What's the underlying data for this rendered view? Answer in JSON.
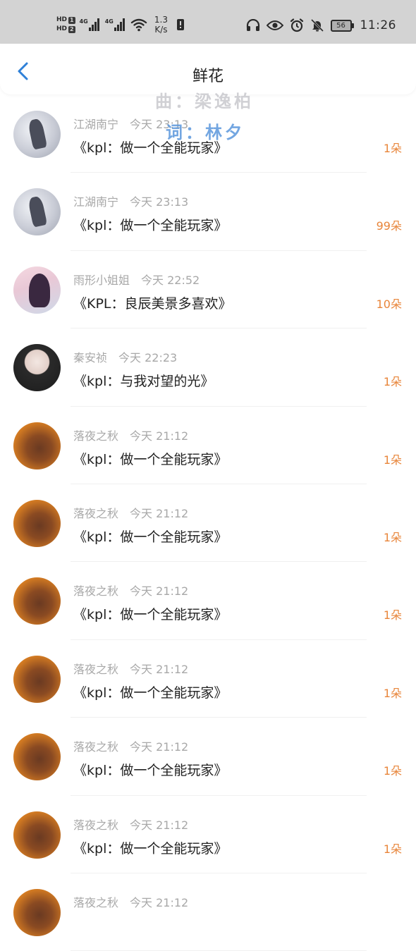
{
  "status_bar": {
    "hd1": "HD",
    "hd1_num": "1",
    "hd2": "HD",
    "hd2_num": "2",
    "sig1_label": "4G",
    "sig2_label": "4G",
    "speed_value": "1.3",
    "speed_unit": "K/s",
    "battery": "56",
    "time": "11:26"
  },
  "header": {
    "title": "鲜花"
  },
  "watermark": {
    "line1": "曲：梁逸柏",
    "line2": "词：林夕"
  },
  "gifts": [
    {
      "avatar": "ink",
      "user": "江湖南宁",
      "time": "今天 23:13",
      "song": "《kpl：做一个全能玩家》",
      "count": "1朵"
    },
    {
      "avatar": "ink",
      "user": "江湖南宁",
      "time": "今天 23:13",
      "song": "《kpl：做一个全能玩家》",
      "count": "99朵"
    },
    {
      "avatar": "girl",
      "user": "雨形小姐姐",
      "time": "今天 22:52",
      "song": "《KPL：良辰美景多喜欢》",
      "count": "10朵"
    },
    {
      "avatar": "photo",
      "user": "秦安祯",
      "time": "今天 22:23",
      "song": "《kpl：与我对望的光》",
      "count": "1朵"
    },
    {
      "avatar": "orange",
      "user": "落夜之秋",
      "time": "今天 21:12",
      "song": "《kpl：做一个全能玩家》",
      "count": "1朵"
    },
    {
      "avatar": "orange",
      "user": "落夜之秋",
      "time": "今天 21:12",
      "song": "《kpl：做一个全能玩家》",
      "count": "1朵"
    },
    {
      "avatar": "orange",
      "user": "落夜之秋",
      "time": "今天 21:12",
      "song": "《kpl：做一个全能玩家》",
      "count": "1朵"
    },
    {
      "avatar": "orange",
      "user": "落夜之秋",
      "time": "今天 21:12",
      "song": "《kpl：做一个全能玩家》",
      "count": "1朵"
    },
    {
      "avatar": "orange",
      "user": "落夜之秋",
      "time": "今天 21:12",
      "song": "《kpl：做一个全能玩家》",
      "count": "1朵"
    },
    {
      "avatar": "orange",
      "user": "落夜之秋",
      "time": "今天 21:12",
      "song": "《kpl：做一个全能玩家》",
      "count": "1朵"
    },
    {
      "avatar": "orange",
      "user": "落夜之秋",
      "time": "今天 21:12",
      "song": "",
      "count": ""
    }
  ],
  "colors": {
    "accent": "#2f80d8",
    "count": "#e8853a",
    "meta": "#a8a8a8"
  },
  "icons": {
    "back": "chevron-left-icon",
    "headphones": "headphones-icon",
    "eye": "eye-icon",
    "alarm": "alarm-icon",
    "mute": "bell-off-icon",
    "wifi": "wifi-icon",
    "battery": "battery-icon",
    "notification": "notification-icon"
  }
}
